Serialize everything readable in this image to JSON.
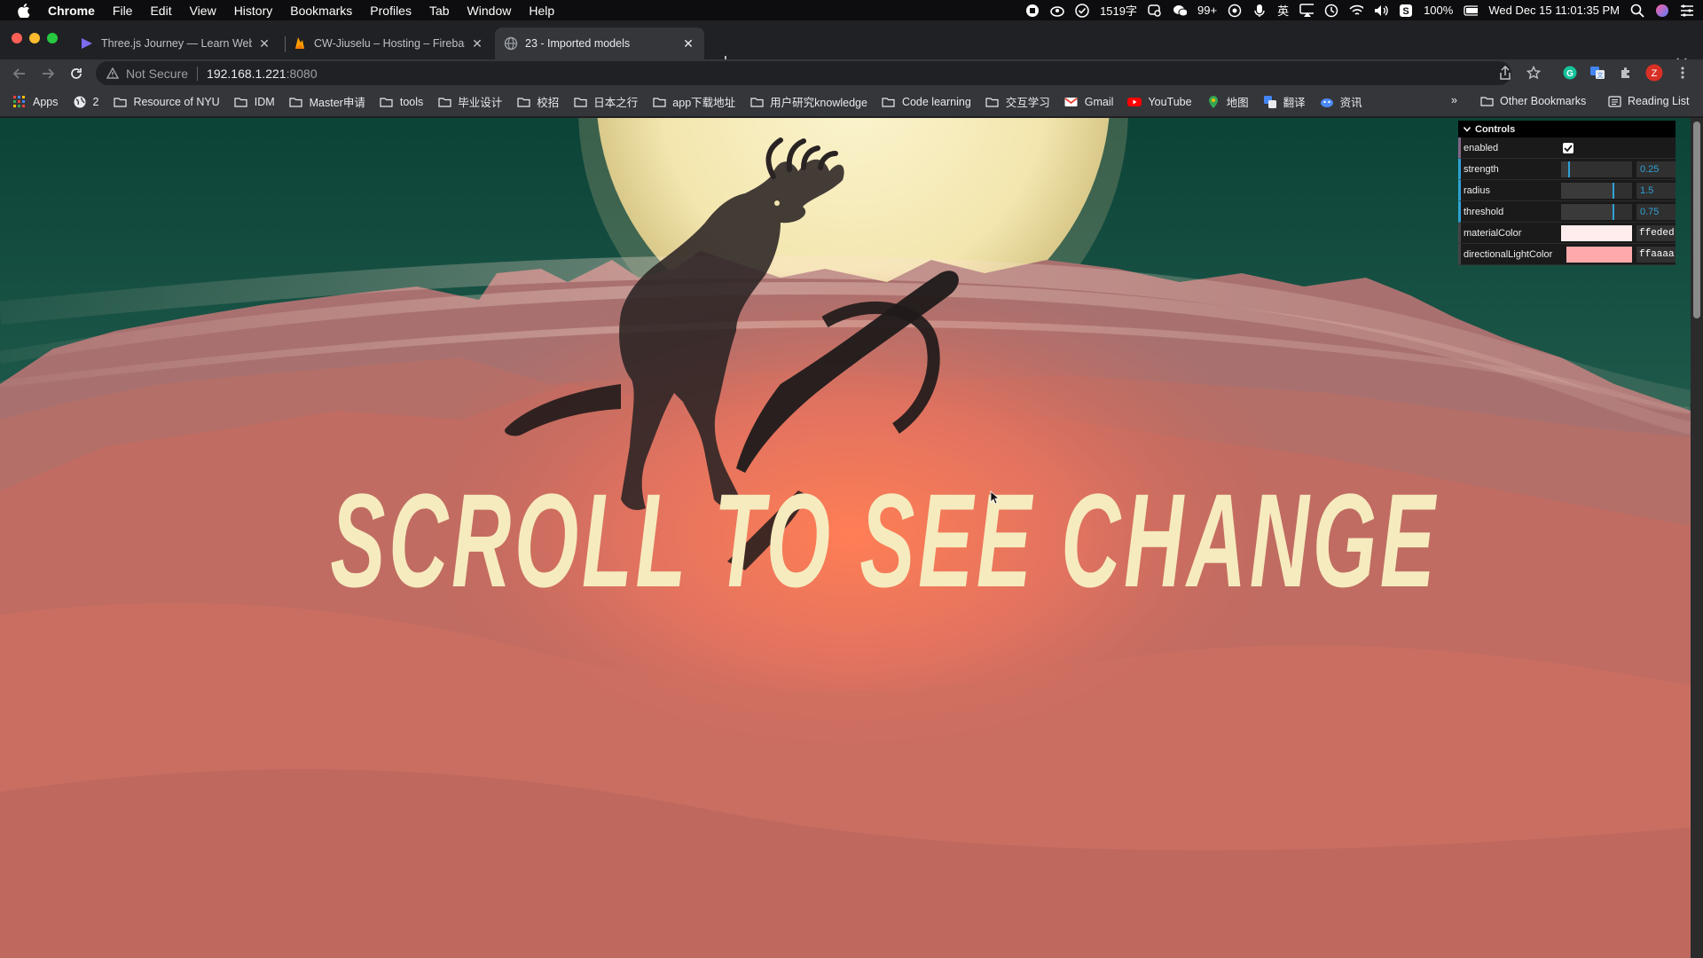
{
  "menubar": {
    "app_name": "Chrome",
    "menus": [
      "File",
      "Edit",
      "View",
      "History",
      "Bookmarks",
      "Profiles",
      "Tab",
      "Window",
      "Help"
    ],
    "status": {
      "word_count": "1519字",
      "wechat_badge": "99+",
      "input_method": "英",
      "battery": "100%",
      "datetime": "Wed Dec 15  11:01:35 PM"
    }
  },
  "tabs": [
    {
      "title": "Three.js Journey — Learn Web",
      "favicon": "threejs-journey-icon"
    },
    {
      "title": "CW-Jiuselu – Hosting – Firebase",
      "favicon": "firebase-icon"
    },
    {
      "title": "23 - Imported models",
      "favicon": "globe-icon",
      "active": true
    }
  ],
  "toolbar": {
    "security_label": "Not Secure",
    "url_host": "192.168.1.221",
    "url_port": ":8080",
    "profile_initial": "Z"
  },
  "bookmarks": {
    "items": [
      {
        "label": "Apps",
        "icon": "apps-grid-icon"
      },
      {
        "label": "2",
        "icon": "globe-icon"
      },
      {
        "label": "Resource of NYU",
        "icon": "folder-icon"
      },
      {
        "label": "IDM",
        "icon": "folder-icon"
      },
      {
        "label": "Master申请",
        "icon": "folder-icon"
      },
      {
        "label": "tools",
        "icon": "folder-icon"
      },
      {
        "label": "毕业设计",
        "icon": "folder-icon"
      },
      {
        "label": "校招",
        "icon": "folder-icon"
      },
      {
        "label": "日本之行",
        "icon": "folder-icon"
      },
      {
        "label": "app下载地址",
        "icon": "folder-icon"
      },
      {
        "label": "用户研究knowledge",
        "icon": "folder-icon"
      },
      {
        "label": "Code learning",
        "icon": "folder-icon"
      },
      {
        "label": "交互学习",
        "icon": "folder-icon"
      },
      {
        "label": "Gmail",
        "icon": "gmail-icon"
      },
      {
        "label": "YouTube",
        "icon": "youtube-icon"
      },
      {
        "label": "地图",
        "icon": "maps-icon"
      },
      {
        "label": "翻译",
        "icon": "translate-icon"
      },
      {
        "label": "资讯",
        "icon": "news-icon"
      }
    ],
    "overflow": "»",
    "other_bookmarks": "Other Bookmarks",
    "reading_list": "Reading List"
  },
  "scene": {
    "headline": "SCROLL TO SEE CHANGE",
    "colors": {
      "sky": "#0f4a3c",
      "moon": "#f7eec0",
      "mountains": "#b86a62",
      "ground": "#c86a5a",
      "text": "#f6ebbf"
    }
  },
  "gui": {
    "title": "Controls",
    "enabled": {
      "label": "enabled",
      "checked": true
    },
    "strength": {
      "label": "strength",
      "value": "0.25"
    },
    "radius": {
      "label": "radius",
      "value": "1.5"
    },
    "threshold": {
      "label": "threshold",
      "value": "0.75"
    },
    "materialColor": {
      "label": "materialColor",
      "value": "ffeded",
      "hex": "#ffeded"
    },
    "directionalLightColor": {
      "label": "directionalLightColor",
      "value": "ffaaaa",
      "hex": "#ffaaaa"
    }
  }
}
